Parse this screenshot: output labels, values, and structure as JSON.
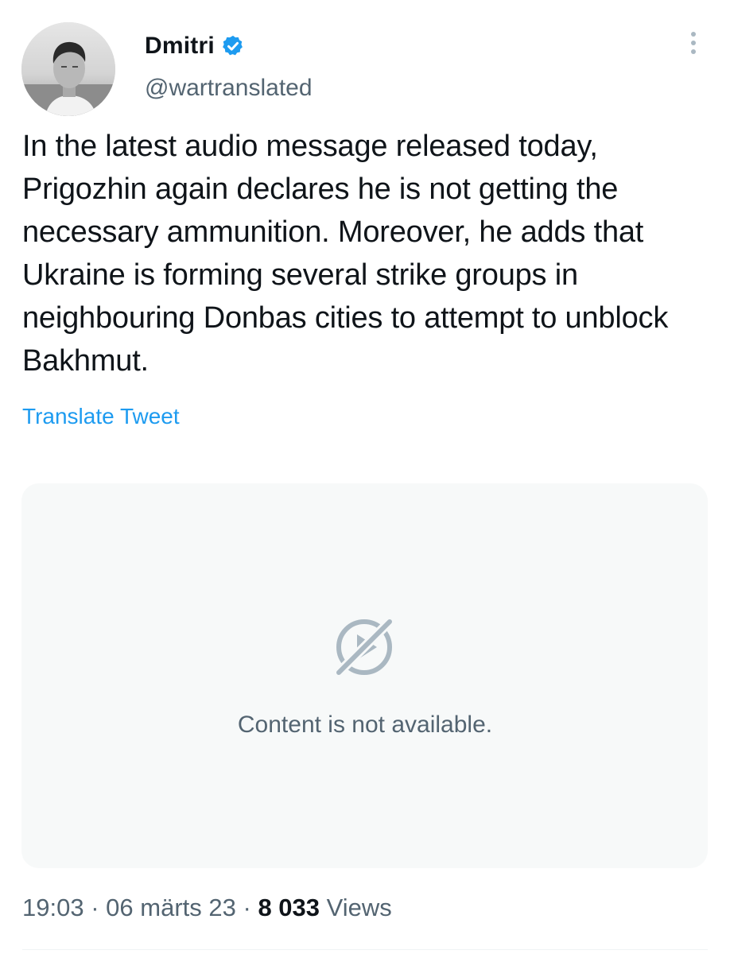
{
  "author": {
    "name": "Dmitri",
    "handle": "@wartranslated",
    "verified": true
  },
  "tweet": {
    "text": "In the latest audio message released today, Prigozhin again declares he is not getting the necessary ammunition. Moreover, he adds that Ukraine is forming several strike groups in neighbouring Donbas cities to attempt to unblock Bakhmut.",
    "translate_label": "Translate Tweet"
  },
  "media": {
    "unavailable_text": "Content is not available.",
    "icon": "video-unavailable-icon"
  },
  "meta": {
    "time": "19:03",
    "separator": "·",
    "date": "06 märts 23",
    "views_count": "8 033",
    "views_label": "Views"
  },
  "colors": {
    "accent": "#1d9bf0",
    "secondary_text": "#536471",
    "card_background": "#f7f9f9"
  }
}
